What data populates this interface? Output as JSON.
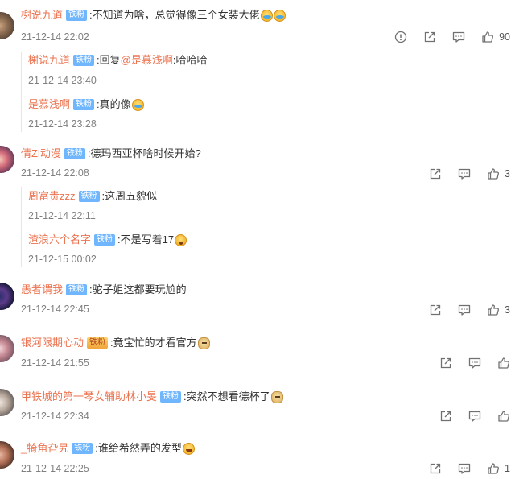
{
  "comments": [
    {
      "user": "榭说九道",
      "badge": "铁粉",
      "text": ":不知道为啥，总觉得像三个女装大佬",
      "emojis": [
        "cry",
        "cry"
      ],
      "time": "21-12-14 22:02",
      "likes": "90",
      "replies": [
        {
          "user": "榭说九道",
          "badge": "铁粉",
          "text": ":回复",
          "mention": "@是慕浅啊",
          "text2": ":哈哈哈",
          "time": "21-12-14 23:40"
        },
        {
          "user": "是慕浅啊",
          "badge": "铁粉",
          "text": ":真的像",
          "emojis": [
            "cry"
          ],
          "time": "21-12-14 23:28"
        }
      ]
    },
    {
      "user": "倩Zi动漫",
      "badge": "铁粉",
      "text": ":德玛西亚杯啥时候开始?",
      "time": "21-12-14 22:08",
      "likes": "3",
      "replies": [
        {
          "user": "周富贵zzz",
          "badge": "铁粉",
          "text": ":这周五貌似",
          "time": "21-12-14 22:11"
        },
        {
          "user": "渣浪六个名字",
          "badge": "铁粉",
          "text": ":不是写着17",
          "emojis": [
            "wow"
          ],
          "time": "21-12-15 00:02"
        }
      ]
    },
    {
      "user": "愚者谓我",
      "badge": "铁粉",
      "text": ":驼子姐这都要玩尬的",
      "time": "21-12-14 22:45",
      "likes": "3"
    },
    {
      "user": "银河限期心动",
      "badge": "铁粉",
      "badge_style": "gold",
      "text": ":竟宝忙的才看官方",
      "emojis": [
        "doge"
      ],
      "time": "21-12-14 21:55"
    },
    {
      "user": "甲铁城的第一琴女辅助林小旻",
      "badge": "铁粉",
      "text": ":突然不想看德杯了",
      "emojis": [
        "doge"
      ],
      "time": "21-12-14 22:34"
    },
    {
      "user": "_犄角旮旯",
      "badge": "铁粉",
      "text": ":谁给希然弄的发型",
      "emojis": [
        "laugh"
      ],
      "time": "21-12-14 22:25",
      "likes": "1"
    }
  ],
  "icons": {
    "report": "info-circle-icon",
    "share": "share-icon",
    "reply": "comment-icon",
    "like": "thumbs-up-icon"
  },
  "colors": {
    "username": "#eb7350",
    "badge": "#6fb6ff",
    "timestamp": "#808080",
    "icon": "#707070"
  }
}
